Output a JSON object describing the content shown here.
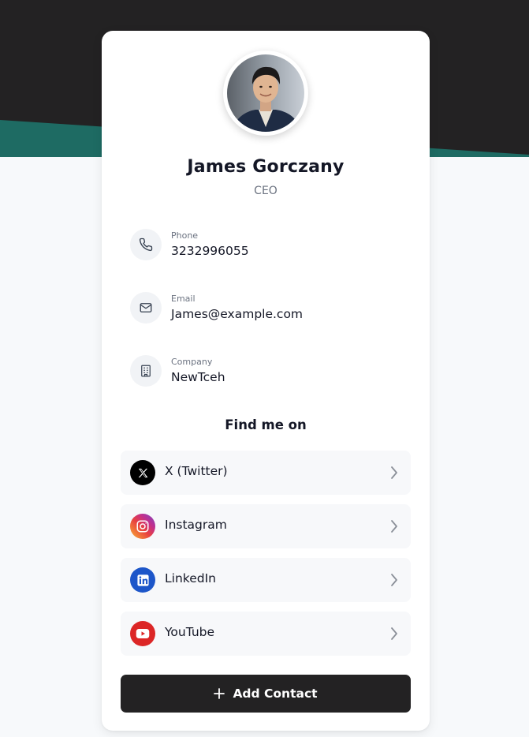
{
  "profile": {
    "name": "James Gorczany",
    "role": "CEO"
  },
  "contact": [
    {
      "label": "Phone",
      "value": "3232996055",
      "icon": "phone-icon"
    },
    {
      "label": "Email",
      "value": "James@example.com",
      "icon": "mail-icon"
    },
    {
      "label": "Company",
      "value": "NewTceh",
      "icon": "building-icon"
    }
  ],
  "social": {
    "title": "Find me on",
    "items": [
      {
        "label": "X (Twitter)",
        "icon": "x-twitter-icon",
        "color": "#000000"
      },
      {
        "label": "Instagram",
        "icon": "instagram-icon",
        "color": "#d6287a"
      },
      {
        "label": "LinkedIn",
        "icon": "linkedin-icon",
        "color": "#1d56c9"
      },
      {
        "label": "YouTube",
        "icon": "youtube-icon",
        "color": "#dc2626"
      }
    ]
  },
  "actions": {
    "add_contact_label": "Add Contact"
  },
  "theme": {
    "hero_dark": "#232223",
    "hero_accent": "#1e6b63",
    "page_background": "#f7f9fb",
    "button_background": "#232223"
  }
}
